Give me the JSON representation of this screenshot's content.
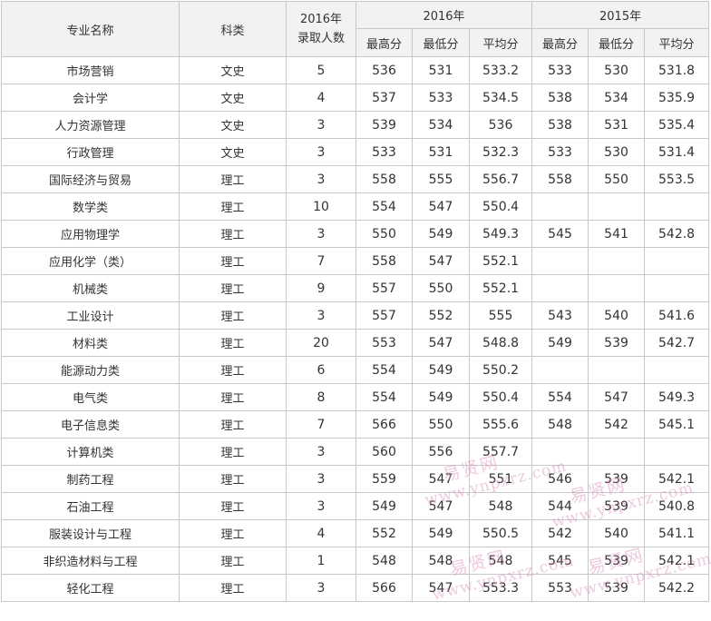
{
  "headers": {
    "major": "专业名称",
    "category": "科类",
    "admitted_line1": "2016年",
    "admitted_line2": "录取人数",
    "year_2016": "2016年",
    "year_2015": "2015年",
    "max": "最高分",
    "min": "最低分",
    "avg": "平均分"
  },
  "rows": [
    {
      "major": "市场营销",
      "category": "文史",
      "count": "5",
      "max16": "536",
      "min16": "531",
      "avg16": "533.2",
      "max15": "533",
      "min15": "530",
      "avg15": "531.8"
    },
    {
      "major": "会计学",
      "category": "文史",
      "count": "4",
      "max16": "537",
      "min16": "533",
      "avg16": "534.5",
      "max15": "538",
      "min15": "534",
      "avg15": "535.9"
    },
    {
      "major": "人力资源管理",
      "category": "文史",
      "count": "3",
      "max16": "539",
      "min16": "534",
      "avg16": "536",
      "max15": "538",
      "min15": "531",
      "avg15": "535.4"
    },
    {
      "major": "行政管理",
      "category": "文史",
      "count": "3",
      "max16": "533",
      "min16": "531",
      "avg16": "532.3",
      "max15": "533",
      "min15": "530",
      "avg15": "531.4"
    },
    {
      "major": "国际经济与贸易",
      "category": "理工",
      "count": "3",
      "max16": "558",
      "min16": "555",
      "avg16": "556.7",
      "max15": "558",
      "min15": "550",
      "avg15": "553.5"
    },
    {
      "major": "数学类",
      "category": "理工",
      "count": "10",
      "max16": "554",
      "min16": "547",
      "avg16": "550.4",
      "max15": "",
      "min15": "",
      "avg15": ""
    },
    {
      "major": "应用物理学",
      "category": "理工",
      "count": "3",
      "max16": "550",
      "min16": "549",
      "avg16": "549.3",
      "max15": "545",
      "min15": "541",
      "avg15": "542.8"
    },
    {
      "major": "应用化学（类）",
      "category": "理工",
      "count": "7",
      "max16": "558",
      "min16": "547",
      "avg16": "552.1",
      "max15": "",
      "min15": "",
      "avg15": ""
    },
    {
      "major": "机械类",
      "category": "理工",
      "count": "9",
      "max16": "557",
      "min16": "550",
      "avg16": "552.1",
      "max15": "",
      "min15": "",
      "avg15": ""
    },
    {
      "major": "工业设计",
      "category": "理工",
      "count": "3",
      "max16": "557",
      "min16": "552",
      "avg16": "555",
      "max15": "543",
      "min15": "540",
      "avg15": "541.6"
    },
    {
      "major": "材料类",
      "category": "理工",
      "count": "20",
      "max16": "553",
      "min16": "547",
      "avg16": "548.8",
      "max15": "549",
      "min15": "539",
      "avg15": "542.7"
    },
    {
      "major": "能源动力类",
      "category": "理工",
      "count": "6",
      "max16": "554",
      "min16": "549",
      "avg16": "550.2",
      "max15": "",
      "min15": "",
      "avg15": ""
    },
    {
      "major": "电气类",
      "category": "理工",
      "count": "8",
      "max16": "554",
      "min16": "549",
      "avg16": "550.4",
      "max15": "554",
      "min15": "547",
      "avg15": "549.3"
    },
    {
      "major": "电子信息类",
      "category": "理工",
      "count": "7",
      "max16": "566",
      "min16": "550",
      "avg16": "555.6",
      "max15": "548",
      "min15": "542",
      "avg15": "545.1"
    },
    {
      "major": "计算机类",
      "category": "理工",
      "count": "3",
      "max16": "560",
      "min16": "556",
      "avg16": "557.7",
      "max15": "",
      "min15": "",
      "avg15": ""
    },
    {
      "major": "制药工程",
      "category": "理工",
      "count": "3",
      "max16": "559",
      "min16": "547",
      "avg16": "551",
      "max15": "546",
      "min15": "539",
      "avg15": "542.1"
    },
    {
      "major": "石油工程",
      "category": "理工",
      "count": "3",
      "max16": "549",
      "min16": "547",
      "avg16": "548",
      "max15": "544",
      "min15": "539",
      "avg15": "540.8"
    },
    {
      "major": "服装设计与工程",
      "category": "理工",
      "count": "4",
      "max16": "552",
      "min16": "549",
      "avg16": "550.5",
      "max15": "542",
      "min15": "540",
      "avg15": "541.1"
    },
    {
      "major": "非织造材料与工程",
      "category": "理工",
      "count": "1",
      "max16": "548",
      "min16": "548",
      "avg16": "548",
      "max15": "545",
      "min15": "539",
      "avg15": "542.1"
    },
    {
      "major": "轻化工程",
      "category": "理工",
      "count": "3",
      "max16": "566",
      "min16": "547",
      "avg16": "553.3",
      "max15": "553",
      "min15": "539",
      "avg15": "542.2"
    }
  ],
  "watermark": {
    "cn": "易贤网",
    "en": "www.ynpxrz.com"
  }
}
